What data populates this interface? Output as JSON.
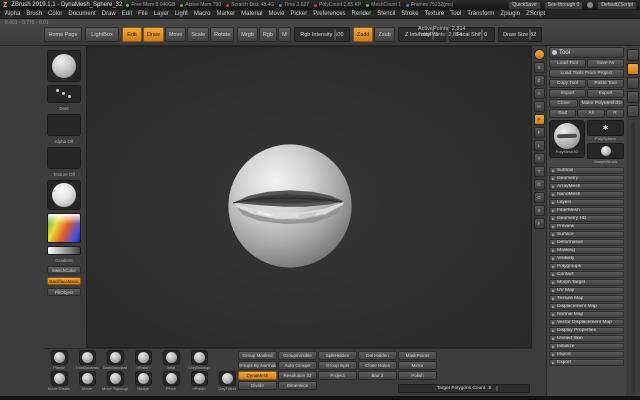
{
  "titlebar": {
    "logo": "Z",
    "title": "ZBrush 2019.1.1 - DynaMesh_Sphere_32",
    "stats": [
      {
        "label": "Free Mem 8.046GB",
        "dot": "#76a83c"
      },
      {
        "label": "Active Mem 790",
        "dot": "#76a83c"
      },
      {
        "label": "Scratch Disk 48.4G",
        "dot": "#b8433c"
      },
      {
        "label": "Time 2.627",
        "dot": "#3c7fb8"
      },
      {
        "label": "PolyCount 2.85 KP",
        "dot": "#b8433c"
      },
      {
        "label": "MeshCount 1",
        "dot": "#76a83c"
      },
      {
        "label": "Frames 75232(ms)",
        "dot": "#3c7fb8"
      }
    ],
    "quicksave": "QuickSave",
    "see_through": "See-through 0",
    "zscript": "DefaultZScript"
  },
  "menubar": {
    "items": [
      "Alpha",
      "Brush",
      "Color",
      "Document",
      "Draw",
      "Edit",
      "File",
      "Layer",
      "Light",
      "Macro",
      "Marker",
      "Material",
      "Movie",
      "Picker",
      "Preferences",
      "Render",
      "Stencil",
      "Stroke",
      "Texture",
      "Tool",
      "Transform",
      "Zplugin",
      "ZScript"
    ]
  },
  "topshelf": {
    "doc_info": "0.401 - 0.776 - 0.01",
    "home_page": "Home Page",
    "lightbox": "LightBox",
    "modes": [
      {
        "label": "Edit",
        "active": true
      },
      {
        "label": "Draw",
        "active": true
      },
      {
        "label": "Move"
      },
      {
        "label": "Scale"
      },
      {
        "label": "Rotate"
      }
    ],
    "paint_modes": [
      {
        "label": "Mrgb"
      },
      {
        "label": "Rgb"
      },
      {
        "label": "M"
      }
    ],
    "rgb_intensity": {
      "label": "Rgb Intensity",
      "value": "100"
    },
    "sculpt_modes": [
      {
        "label": "Zadd",
        "active": true
      },
      {
        "label": "Zsub"
      }
    ],
    "z_intensity": {
      "label": "Z Intensity",
      "value": "25"
    },
    "focal_shift": {
      "label": "Focal Shift",
      "value": "0"
    },
    "draw_size": {
      "label": "Draw Size",
      "value": "32"
    },
    "points": [
      {
        "label": "ActivePoints:",
        "value": "2,814"
      },
      {
        "label": "TotalPoints:",
        "value": "2,814"
      }
    ]
  },
  "left_tray": {
    "stroke_label": "Dots",
    "alpha_label": "Alpha Off",
    "texture_label": "Texture Off",
    "switch_color": "SwitchColor",
    "gradient_label": "Gradient",
    "backface_mask": "BackfaceMask",
    "fill_object": "FillObject"
  },
  "right_shelf": {
    "icons": [
      {
        "name": "bpr-render-button",
        "glyph": "",
        "round": true,
        "active": true
      },
      {
        "name": "scroll-canvas-icon",
        "glyph": "S"
      },
      {
        "name": "zoom-canvas-icon",
        "glyph": "Z"
      },
      {
        "name": "actual-size-icon",
        "glyph": "A"
      },
      {
        "name": "aa-half-icon",
        "glyph": "H"
      },
      {
        "name": "persp-icon",
        "glyph": "P",
        "active": true
      },
      {
        "name": "floor-grid-icon",
        "glyph": "F"
      },
      {
        "name": "local-symmetry-icon",
        "glyph": "L"
      },
      {
        "name": "activate-symmetry-icon",
        "glyph": "Y"
      },
      {
        "name": "transparency-icon",
        "glyph": "T"
      },
      {
        "name": "ghost-transparency-icon",
        "glyph": "G"
      },
      {
        "name": "solo-mode-icon",
        "glyph": "O"
      },
      {
        "name": "xpose-icon",
        "glyph": "X"
      },
      {
        "name": "frame-mesh-icon",
        "glyph": "F"
      }
    ]
  },
  "tool_panel": {
    "header": "Tool",
    "rows": [
      [
        "Load Tool",
        "Save As"
      ],
      [
        "Load Tools From Project"
      ],
      [
        "Copy Tool",
        "Paste Tool"
      ],
      [
        "Import",
        "Export"
      ],
      [
        "Clone",
        "Make PolyMesh3D"
      ],
      [
        "GoZ",
        "All",
        "R"
      ]
    ],
    "current_tool_label": "PolyMesh3D",
    "recent_tools": [
      {
        "label": "PolySphere"
      },
      {
        "label": "SimpleBrush"
      }
    ],
    "sections": [
      "Subtool",
      "Geometry",
      "ArrayMesh",
      "NanoMesh",
      "Layers",
      "FiberMesh",
      "Geometry HD",
      "Preview",
      "Surface",
      "Deformation",
      "Masking",
      "Visibility",
      "Polygroups",
      "Contact",
      "Morph Target",
      "UV Map",
      "Texture Map",
      "Displacement Map",
      "Normal Map",
      "Vector Displacement Map",
      "Display Properties",
      "Unified Skin",
      "Initialize",
      "Import",
      "Export"
    ]
  },
  "bottom": {
    "brushes_row1": [
      "Planar",
      "TrimDynamic",
      "DamStandard",
      "hPolish",
      "Inflat",
      "ClayBuildup"
    ],
    "brushes_row2": [
      "Move Elastic",
      "Move",
      "Move Topological",
      "Nudge",
      "Pinch",
      "hPolish",
      "ClayTubes"
    ],
    "group_row1": [
      "Group Masked",
      "GroupsVisible",
      "SplitHidden",
      "Del Hidden",
      "MaskPoints"
    ],
    "group_row2": [
      "Groups By Normals",
      "Auto Groups",
      "Group Split",
      "Close Holes",
      "Mirror"
    ],
    "dyn_row": [
      {
        "label": "DynaMesh",
        "active": true
      },
      {
        "label": "Resolution 32"
      },
      {
        "label": "Project"
      },
      {
        "label": "Blur 2"
      },
      {
        "label": "Polish"
      }
    ],
    "bottom_row": [
      {
        "label": "Divide"
      },
      {
        "label": "Dimension"
      }
    ],
    "target": {
      "label": "Target Polygons Count",
      "value": ".5"
    }
  },
  "edge": {
    "icons": [
      {
        "name": "right-tray-divider-icon"
      },
      {
        "name": "quick-pick-dock-icon",
        "active": true
      },
      {
        "name": "brush-dock-icon"
      },
      {
        "name": "material-dock-icon"
      },
      {
        "name": "alpha-dock-icon"
      }
    ]
  }
}
